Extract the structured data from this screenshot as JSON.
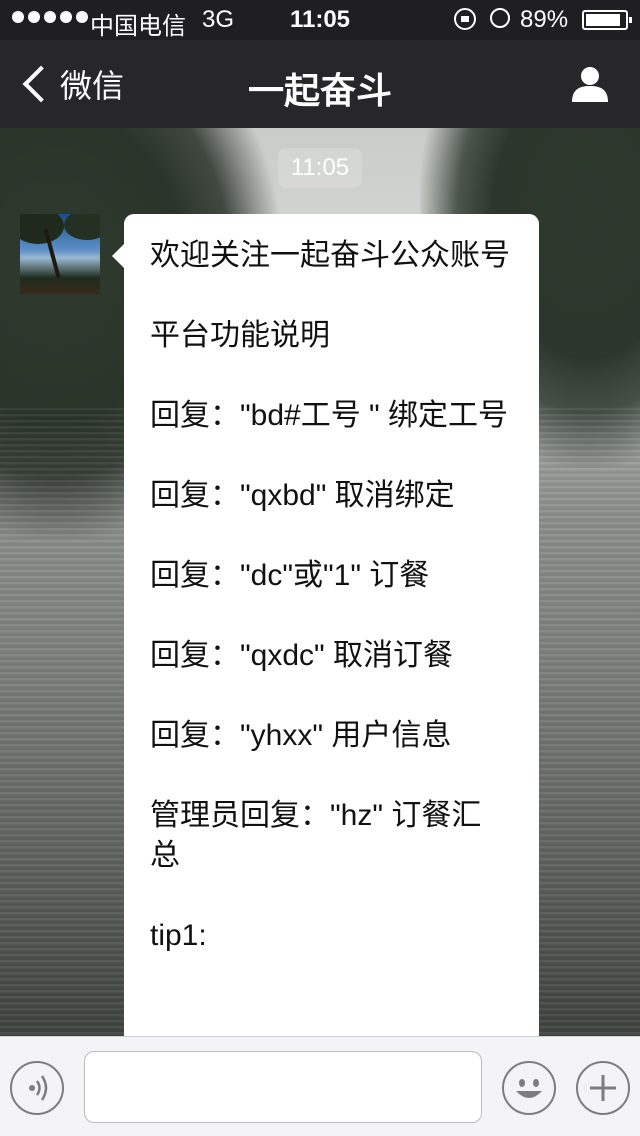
{
  "status_bar": {
    "carrier": "中国电信",
    "network": "3G",
    "time": "11:05",
    "battery_pct_text": "89%",
    "battery_level": 0.89,
    "signal_dots": 5
  },
  "nav": {
    "back_label": "微信",
    "title": "一起奋斗",
    "profile_icon": "person-icon"
  },
  "chat": {
    "timestamp": "11:05",
    "messages": [
      {
        "sender": "official-account",
        "text": "欢迎关注一起奋斗公众账号\n\n平台功能说明\n\n回复：\"bd#工号 \" 绑定工号\n\n回复：\"qxbd\" 取消绑定\n\n回复：\"dc\"或\"1\" 订餐\n\n回复：\"qxdc\" 取消订餐\n\n回复：\"yhxx\" 用户信息\n\n管理员回复：\"hz\" 订餐汇总\n\ntip1:"
      }
    ]
  },
  "input_bar": {
    "voice_icon": "voice-icon",
    "emoji_icon": "emoji-icon",
    "plus_icon": "plus-icon",
    "text_value": ""
  },
  "colors": {
    "status_bar_bg": "#1f1f21",
    "nav_bg": "#27272a",
    "bubble_bg": "#ffffff",
    "input_bar_bg": "#f4f4f6"
  }
}
